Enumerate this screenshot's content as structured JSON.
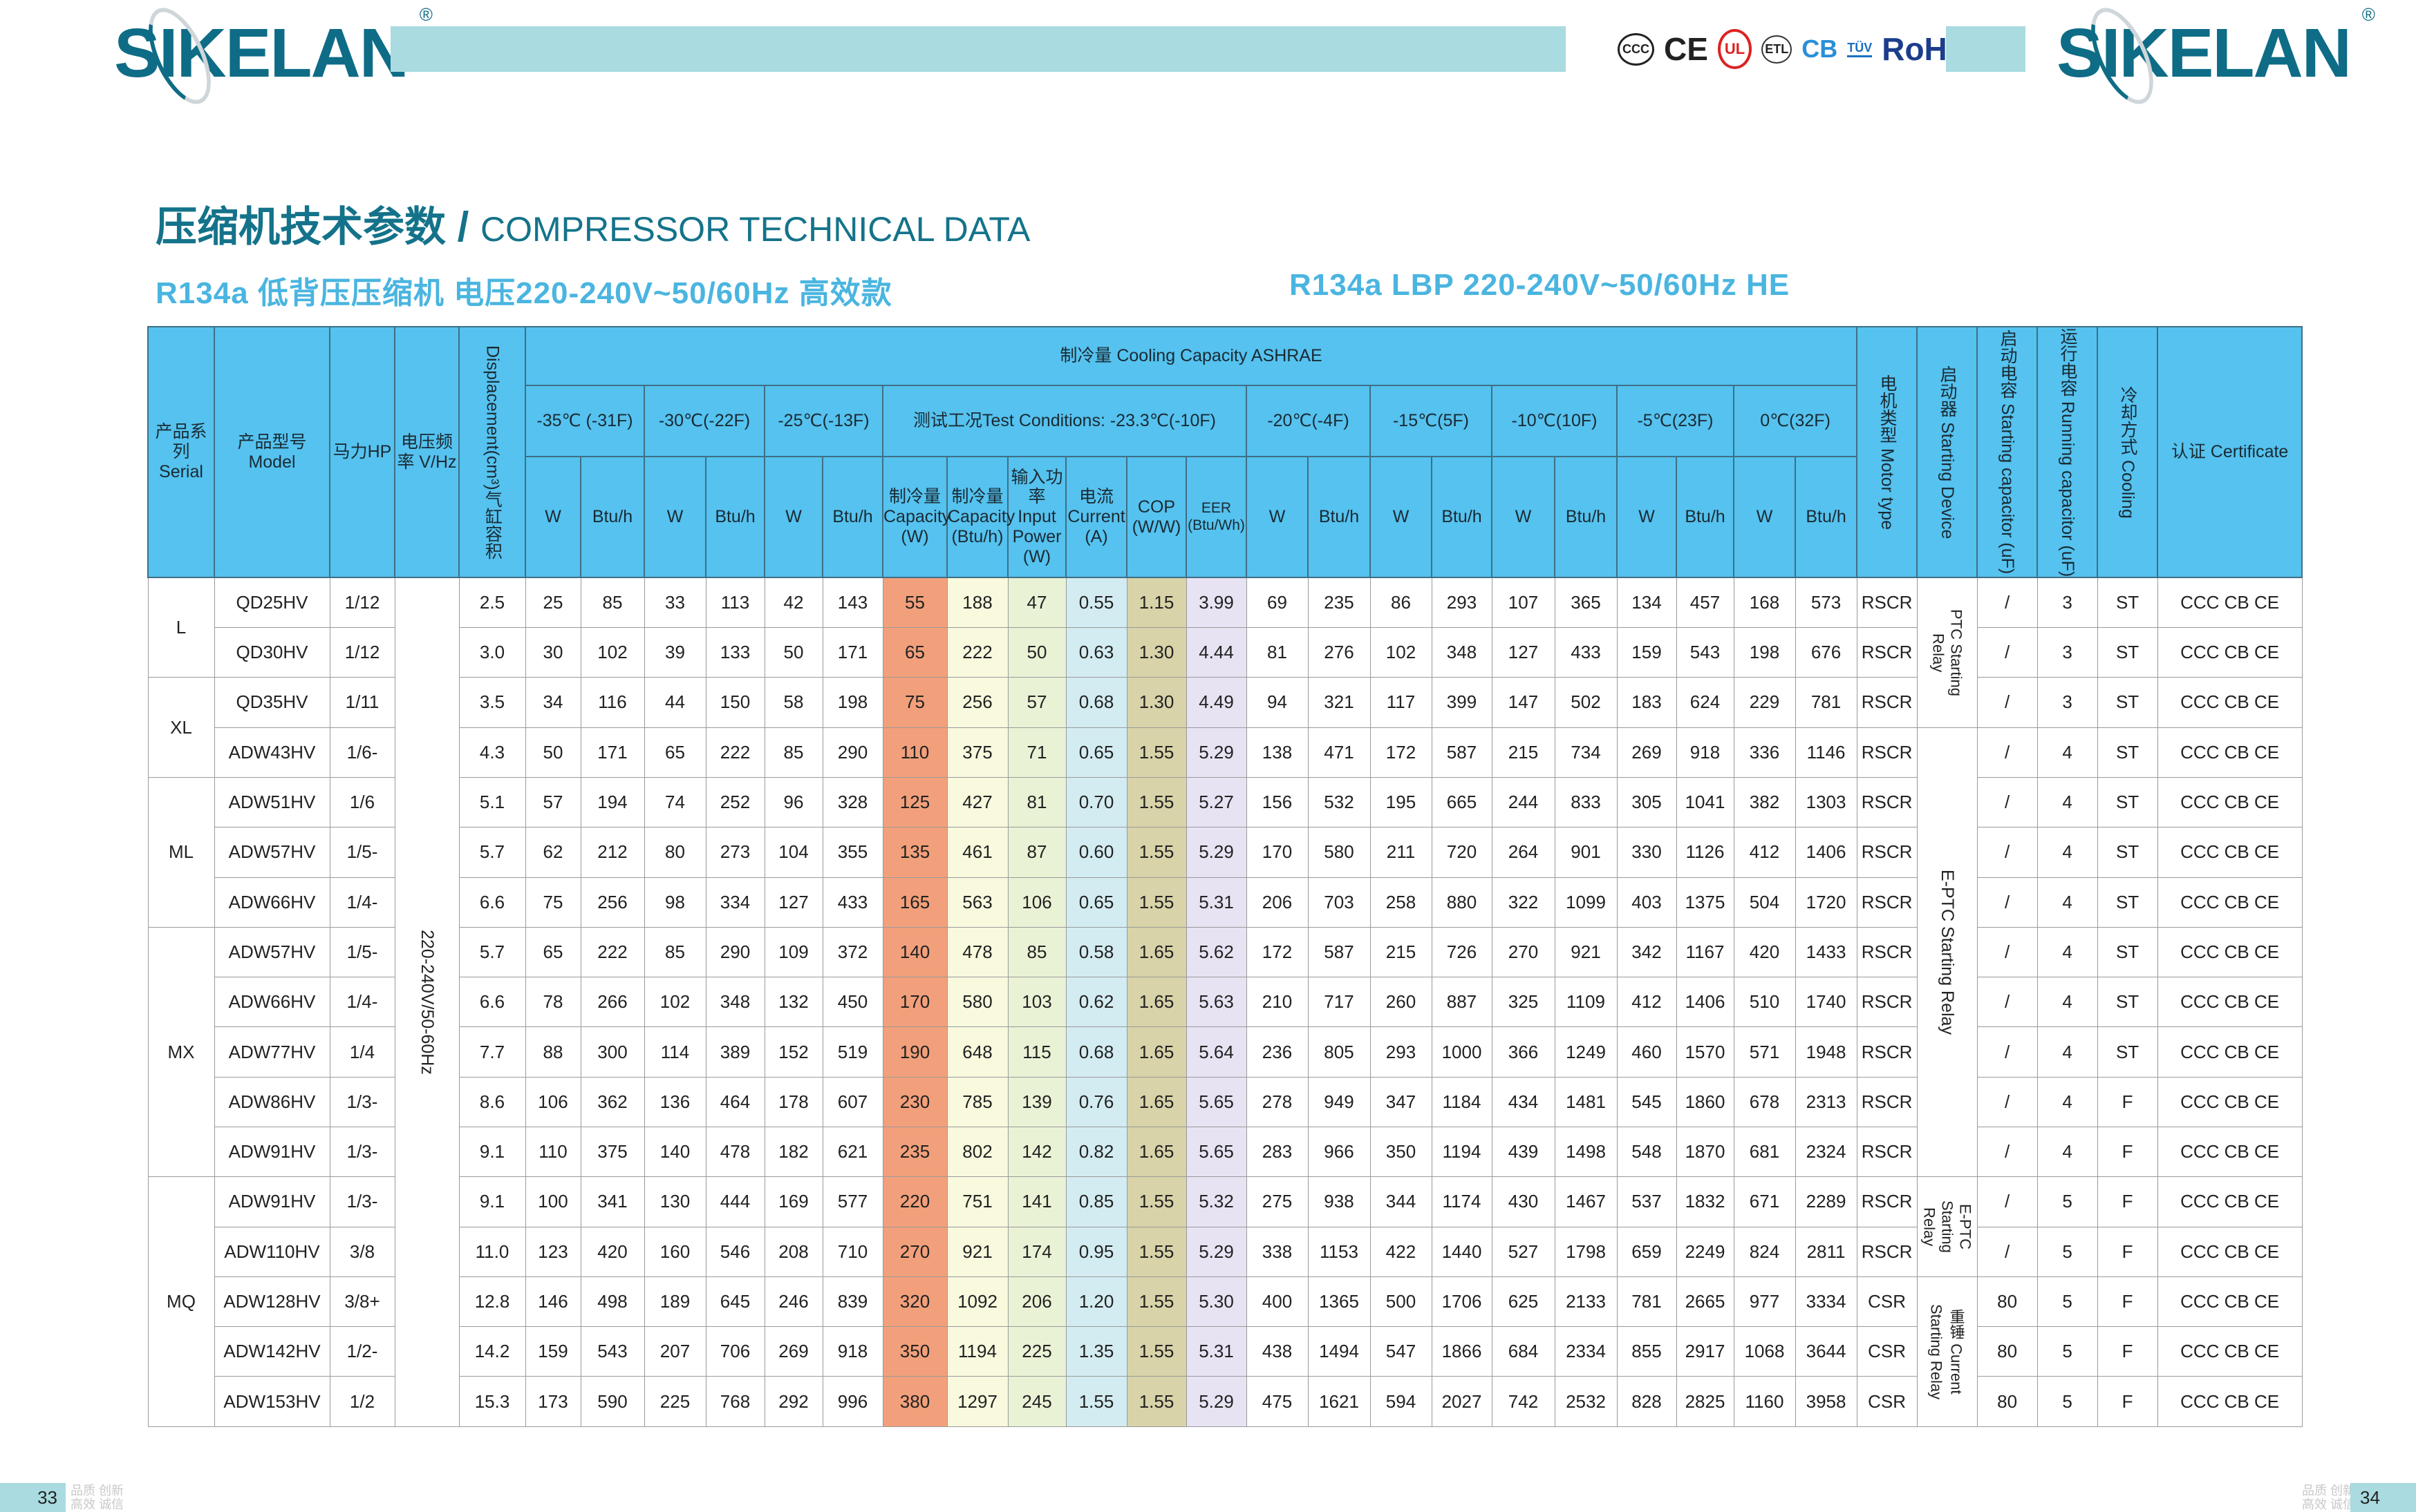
{
  "brand": {
    "logo": "SIKELAN",
    "registered": "®"
  },
  "certifications": [
    "CCC",
    "CE",
    "UL",
    "ETL",
    "CB",
    "TÜV",
    "RoHS"
  ],
  "title": {
    "cn": "压缩机技术参数",
    "sep": " / ",
    "en": "COMPRESSOR TECHNICAL DATA"
  },
  "subtitle": {
    "left": "R134a  低背压压缩机  电压220-240V~50/60Hz  高效款",
    "right": "R134a  LBP  220-240V~50/60Hz  HE"
  },
  "colors": {
    "header": "#55c2ef",
    "capacity_w": "#f2a07b",
    "capacity_btu": "#f8f9dd",
    "input_power": "#e9f2d5",
    "current": "#d3ecf1",
    "cop": "#d8d3a8",
    "eer": "#e7e3f3",
    "brand": "#0e6c86"
  },
  "headers": {
    "serial": "产品系列 Serial",
    "model": "产品型号 Model",
    "hp": "马力HP",
    "vhz": "电压频率 V/Hz",
    "disp": "Displacement(cm³)气缸容积",
    "cooling": "制冷量    Cooling  Capacity  ASHRAE",
    "c35": "-35℃ (-31F)",
    "c30": "-30℃(-22F)",
    "c25": "-25℃(-13F)",
    "test": "测试工况Test Conditions: -23.3℃(-10F)",
    "c20": "-20℃(-4F)",
    "c15": "-15℃(5F)",
    "c10": "-10℃(10F)",
    "c5": "-5℃(23F)",
    "c0": "0℃(32F)",
    "w": "W",
    "btu": "Btu/h",
    "cap_w": "制冷量 Capacity (W)",
    "cap_btu": "制冷量 Capacity (Btu/h)",
    "input": "输入功率 Input Power (W)",
    "current": "电流 Current (A)",
    "cop": "COP (W/W)",
    "eer": "EER (Btu/Wh)",
    "motor": "电机类型 Motor type",
    "device": "启动器 Starting Device",
    "start_cap": "启动电容 Starting capacitor (uF)",
    "run_cap": "运行电容 Running capacitor (uF)",
    "cooling_mode": "冷却方式 Cooling",
    "cert": "认证 Certificate"
  },
  "voltage": "220-240V/50-60Hz",
  "serial_groups": [
    {
      "label": "L",
      "rows": 2
    },
    {
      "label": "XL",
      "rows": 2
    },
    {
      "label": "ML",
      "rows": 3
    },
    {
      "label": "MX",
      "rows": 5
    },
    {
      "label": "MQ",
      "rows": 5
    }
  ],
  "device_groups": [
    {
      "label": "PTC Starting Relay",
      "rows": 3
    },
    {
      "label": "E-PTC Starting Relay",
      "rows": 9
    },
    {
      "label": "E-PTC Starting Relay",
      "rows": 2
    },
    {
      "label": "重锤 Current Starting Relay",
      "rows": 3
    }
  ],
  "rows": [
    {
      "model": "QD25HV",
      "hp": "1/12",
      "disp": "2.5",
      "v": [
        25,
        85,
        33,
        113,
        42,
        143,
        55,
        188,
        47,
        "0.55",
        "1.15",
        "3.99",
        69,
        235,
        86,
        293,
        107,
        365,
        134,
        457,
        168,
        573
      ],
      "motor": "RSCR",
      "scap": "/",
      "rcap": "3",
      "cool": "ST",
      "cert": "CCC CB CE"
    },
    {
      "model": "QD30HV",
      "hp": "1/12",
      "disp": "3.0",
      "v": [
        30,
        102,
        39,
        133,
        50,
        171,
        65,
        222,
        50,
        "0.63",
        "1.30",
        "4.44",
        81,
        276,
        102,
        348,
        127,
        433,
        159,
        543,
        198,
        676
      ],
      "motor": "RSCR",
      "scap": "/",
      "rcap": "3",
      "cool": "ST",
      "cert": "CCC CB CE"
    },
    {
      "model": "QD35HV",
      "hp": "1/11",
      "disp": "3.5",
      "v": [
        34,
        116,
        44,
        150,
        58,
        198,
        75,
        256,
        57,
        "0.68",
        "1.30",
        "4.49",
        94,
        321,
        117,
        399,
        147,
        502,
        183,
        624,
        229,
        781
      ],
      "motor": "RSCR",
      "scap": "/",
      "rcap": "3",
      "cool": "ST",
      "cert": "CCC CB CE"
    },
    {
      "model": "ADW43HV",
      "hp": "1/6-",
      "disp": "4.3",
      "v": [
        50,
        171,
        65,
        222,
        85,
        290,
        110,
        375,
        71,
        "0.65",
        "1.55",
        "5.29",
        138,
        471,
        172,
        587,
        215,
        734,
        269,
        918,
        336,
        1146
      ],
      "motor": "RSCR",
      "scap": "/",
      "rcap": "4",
      "cool": "ST",
      "cert": "CCC CB CE"
    },
    {
      "model": "ADW51HV",
      "hp": "1/6",
      "disp": "5.1",
      "v": [
        57,
        194,
        74,
        252,
        96,
        328,
        125,
        427,
        81,
        "0.70",
        "1.55",
        "5.27",
        156,
        532,
        195,
        665,
        244,
        833,
        305,
        1041,
        382,
        1303
      ],
      "motor": "RSCR",
      "scap": "/",
      "rcap": "4",
      "cool": "ST",
      "cert": "CCC CB CE"
    },
    {
      "model": "ADW57HV",
      "hp": "1/5-",
      "disp": "5.7",
      "v": [
        62,
        212,
        80,
        273,
        104,
        355,
        135,
        461,
        87,
        "0.60",
        "1.55",
        "5.29",
        170,
        580,
        211,
        720,
        264,
        901,
        330,
        1126,
        412,
        1406
      ],
      "motor": "RSCR",
      "scap": "/",
      "rcap": "4",
      "cool": "ST",
      "cert": "CCC CB CE"
    },
    {
      "model": "ADW66HV",
      "hp": "1/4-",
      "disp": "6.6",
      "v": [
        75,
        256,
        98,
        334,
        127,
        433,
        165,
        563,
        106,
        "0.65",
        "1.55",
        "5.31",
        206,
        703,
        258,
        880,
        322,
        1099,
        403,
        1375,
        504,
        1720
      ],
      "motor": "RSCR",
      "scap": "/",
      "rcap": "4",
      "cool": "ST",
      "cert": "CCC CB CE"
    },
    {
      "model": "ADW57HV",
      "hp": "1/5-",
      "disp": "5.7",
      "v": [
        65,
        222,
        85,
        290,
        109,
        372,
        140,
        478,
        85,
        "0.58",
        "1.65",
        "5.62",
        172,
        587,
        215,
        726,
        270,
        921,
        342,
        1167,
        420,
        1433
      ],
      "motor": "RSCR",
      "scap": "/",
      "rcap": "4",
      "cool": "ST",
      "cert": "CCC CB CE"
    },
    {
      "model": "ADW66HV",
      "hp": "1/4-",
      "disp": "6.6",
      "v": [
        78,
        266,
        102,
        348,
        132,
        450,
        170,
        580,
        103,
        "0.62",
        "1.65",
        "5.63",
        210,
        717,
        260,
        887,
        325,
        1109,
        412,
        1406,
        510,
        1740
      ],
      "motor": "RSCR",
      "scap": "/",
      "rcap": "4",
      "cool": "ST",
      "cert": "CCC CB CE"
    },
    {
      "model": "ADW77HV",
      "hp": "1/4",
      "disp": "7.7",
      "v": [
        88,
        300,
        114,
        389,
        152,
        519,
        190,
        648,
        115,
        "0.68",
        "1.65",
        "5.64",
        236,
        805,
        293,
        1000,
        366,
        1249,
        460,
        1570,
        571,
        1948
      ],
      "motor": "RSCR",
      "scap": "/",
      "rcap": "4",
      "cool": "ST",
      "cert": "CCC CB CE"
    },
    {
      "model": "ADW86HV",
      "hp": "1/3-",
      "disp": "8.6",
      "v": [
        106,
        362,
        136,
        464,
        178,
        607,
        230,
        785,
        139,
        "0.76",
        "1.65",
        "5.65",
        278,
        949,
        347,
        1184,
        434,
        1481,
        545,
        1860,
        678,
        2313
      ],
      "motor": "RSCR",
      "scap": "/",
      "rcap": "4",
      "cool": "F",
      "cert": "CCC CB CE"
    },
    {
      "model": "ADW91HV",
      "hp": "1/3-",
      "disp": "9.1",
      "v": [
        110,
        375,
        140,
        478,
        182,
        621,
        235,
        802,
        142,
        "0.82",
        "1.65",
        "5.65",
        283,
        966,
        350,
        1194,
        439,
        1498,
        548,
        1870,
        681,
        2324
      ],
      "motor": "RSCR",
      "scap": "/",
      "rcap": "4",
      "cool": "F",
      "cert": "CCC CB CE"
    },
    {
      "model": "ADW91HV",
      "hp": "1/3-",
      "disp": "9.1",
      "v": [
        100,
        341,
        130,
        444,
        169,
        577,
        220,
        751,
        141,
        "0.85",
        "1.55",
        "5.32",
        275,
        938,
        344,
        1174,
        430,
        1467,
        537,
        1832,
        671,
        2289
      ],
      "motor": "RSCR",
      "scap": "/",
      "rcap": "5",
      "cool": "F",
      "cert": "CCC CB CE"
    },
    {
      "model": "ADW110HV",
      "hp": "3/8",
      "disp": "11.0",
      "v": [
        123,
        420,
        160,
        546,
        208,
        710,
        270,
        921,
        174,
        "0.95",
        "1.55",
        "5.29",
        338,
        1153,
        422,
        1440,
        527,
        1798,
        659,
        2249,
        824,
        2811
      ],
      "motor": "RSCR",
      "scap": "/",
      "rcap": "5",
      "cool": "F",
      "cert": "CCC CB CE"
    },
    {
      "model": "ADW128HV",
      "hp": "3/8+",
      "disp": "12.8",
      "v": [
        146,
        498,
        189,
        645,
        246,
        839,
        320,
        1092,
        206,
        "1.20",
        "1.55",
        "5.30",
        400,
        1365,
        500,
        1706,
        625,
        2133,
        781,
        2665,
        977,
        3334
      ],
      "motor": "CSR",
      "scap": "80",
      "rcap": "5",
      "cool": "F",
      "cert": "CCC CB CE"
    },
    {
      "model": "ADW142HV",
      "hp": "1/2-",
      "disp": "14.2",
      "v": [
        159,
        543,
        207,
        706,
        269,
        918,
        350,
        1194,
        225,
        "1.35",
        "1.55",
        "5.31",
        438,
        1494,
        547,
        1866,
        684,
        2334,
        855,
        2917,
        1068,
        3644
      ],
      "motor": "CSR",
      "scap": "80",
      "rcap": "5",
      "cool": "F",
      "cert": "CCC CB CE"
    },
    {
      "model": "ADW153HV",
      "hp": "1/2",
      "disp": "15.3",
      "v": [
        173,
        590,
        225,
        768,
        292,
        996,
        380,
        1297,
        245,
        "1.55",
        "1.55",
        "5.29",
        475,
        1621,
        594,
        2027,
        742,
        2532,
        828,
        2825,
        1160,
        3958
      ],
      "motor": "CSR",
      "scap": "80",
      "rcap": "5",
      "cool": "F",
      "cert": "CCC CB CE"
    }
  ],
  "footer": {
    "left_page": "33",
    "right_page": "34",
    "slogan_1": "品质 创新",
    "slogan_2": "高效 诚信"
  }
}
